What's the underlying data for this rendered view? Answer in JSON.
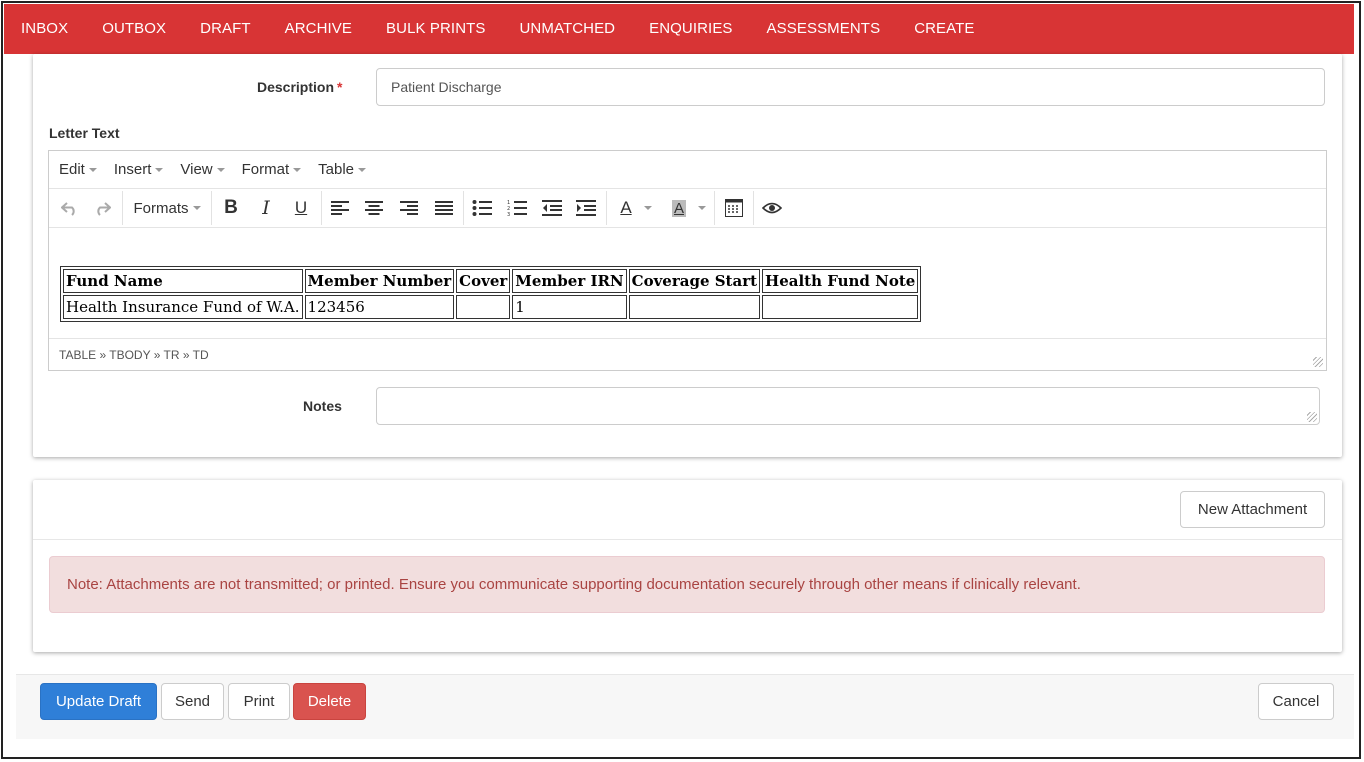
{
  "nav": {
    "items": [
      "INBOX",
      "OUTBOX",
      "DRAFT",
      "ARCHIVE",
      "BULK PRINTS",
      "UNMATCHED",
      "ENQUIRIES",
      "ASSESSMENTS",
      "CREATE"
    ],
    "color": "#d83435"
  },
  "form": {
    "description_label": "Description",
    "required_marker": "*",
    "description_value": "Patient Discharge",
    "letter_text_label": "Letter Text",
    "notes_label": "Notes",
    "notes_value": ""
  },
  "editor": {
    "menu": [
      "Edit",
      "Insert",
      "View",
      "Format",
      "Table"
    ],
    "formats_label": "Formats",
    "toolbar_icons": [
      "undo-icon",
      "redo-icon",
      "bold-icon",
      "italic-icon",
      "underline-icon",
      "align-left-icon",
      "align-center-icon",
      "align-right-icon",
      "align-justify-icon",
      "bullet-list-icon",
      "numbered-list-icon",
      "outdent-icon",
      "indent-icon",
      "text-color-icon",
      "background-color-icon",
      "table-grid-icon",
      "preview-icon"
    ],
    "table": {
      "headers": [
        "Fund Name",
        "Member Number",
        "Cover",
        "Member IRN",
        "Coverage Start",
        "Health Fund Note"
      ],
      "rows": [
        [
          "Health Insurance Fund of W.A.",
          "123456",
          "",
          "1",
          "",
          ""
        ]
      ]
    },
    "status_path": "TABLE » TBODY » TR » TD"
  },
  "attachments": {
    "new_button": "New Attachment",
    "note": "Note: Attachments are not transmitted; or printed. Ensure you communicate supporting documentation securely through other means if clinically relevant."
  },
  "actions": {
    "update_draft": "Update Draft",
    "send": "Send",
    "print": "Print",
    "delete": "Delete",
    "cancel": "Cancel",
    "primary_color": "#2f7fd8",
    "danger_color": "#d9534f"
  }
}
